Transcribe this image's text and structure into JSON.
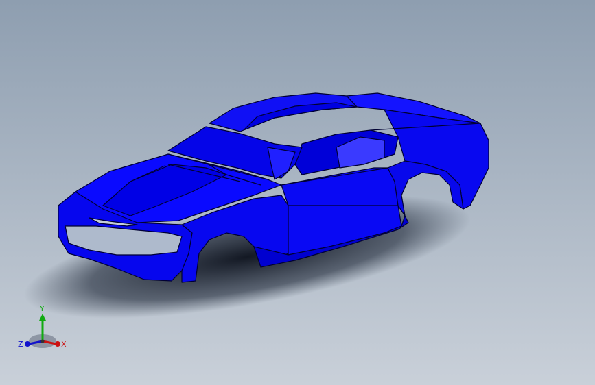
{
  "viewport": {
    "background_top": "#8e9eb0",
    "background_bottom": "#c9d0d9"
  },
  "model": {
    "body_color": "#0a0af0",
    "edge_color": "#000033"
  },
  "triad": {
    "x_label": "X",
    "y_label": "Y",
    "z_label": "Z",
    "x_color": "#cc1111",
    "y_color": "#11aa11",
    "z_color": "#1111cc"
  }
}
